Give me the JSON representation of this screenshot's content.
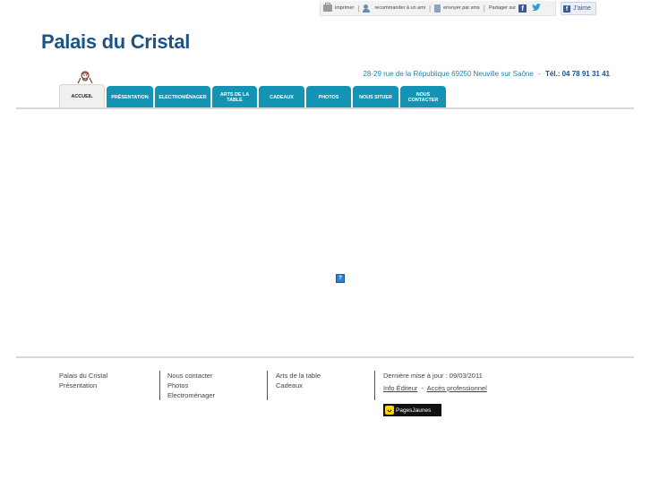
{
  "toolbar": {
    "print_label": "imprimer",
    "recommend_label": "recommander à un ami",
    "send_label": "envoyer par sms",
    "share_label": "Partager sur",
    "separator": "|",
    "like_label": "J'aime",
    "facebook_glyph": "f"
  },
  "header": {
    "site_title": "Palais du Cristal",
    "address": "28-29 rue de la République 69250 Neuville sur Saône",
    "address_separator": "-",
    "phone": "Tél.: 04 78 91 31 41"
  },
  "nav": {
    "tabs": [
      {
        "label": "ACCUEIL",
        "active": true
      },
      {
        "label": "PRÉSENTATION",
        "active": false
      },
      {
        "label": "ELECTROMÉNAGER",
        "active": false
      },
      {
        "label": "ARTS DE LA TABLE",
        "active": false
      },
      {
        "label": "CADEAUX",
        "active": false
      },
      {
        "label": "PHOTOS",
        "active": false
      },
      {
        "label": "NOUS SITUER",
        "active": false
      },
      {
        "label": "NOUS CONTACTER",
        "active": false
      }
    ]
  },
  "content": {
    "placeholder_icon": "?"
  },
  "footer": {
    "col1": [
      "Palais du Cristal",
      "Présentation"
    ],
    "col2": [
      "Nous contacter",
      "Photos",
      "Electroménager"
    ],
    "col3": [
      "Arts de la table",
      "Cadeaux"
    ],
    "last_update": "Dernière mise à jour : 09/03/2011",
    "info_editeur": "Info Éditeur",
    "link_separator": "-",
    "acces_pro": "Accès professionnel",
    "pages_jaunes": "PagesJaunes",
    "pages_jaunes_glyph": "ᴗ"
  },
  "colors": {
    "title": "#1c5487",
    "tab": "#1493b4",
    "address": "#2a7fa8"
  }
}
